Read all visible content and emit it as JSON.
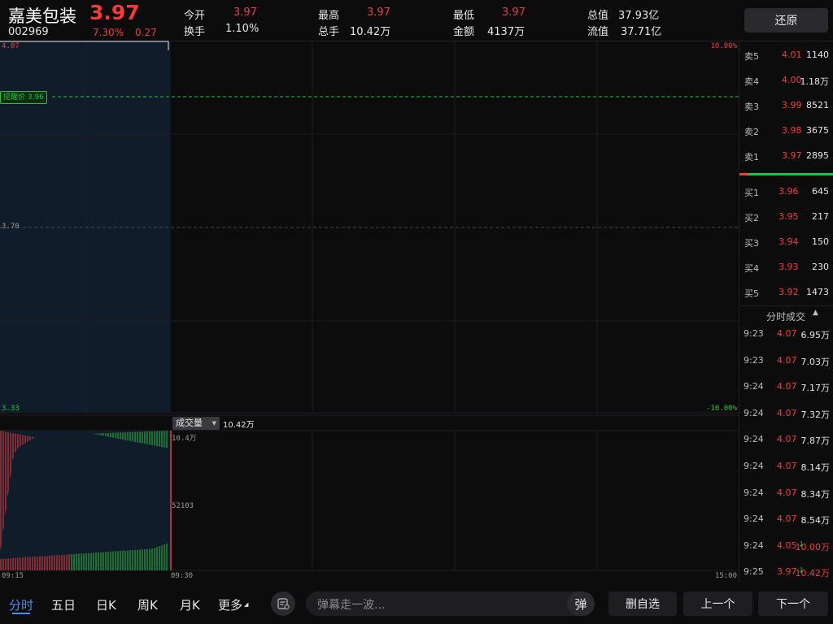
{
  "stock": {
    "name": "嘉美包装",
    "price": "3.97",
    "code": "002969",
    "change_pct": "7.30%",
    "change_amt": "0.27"
  },
  "stats": [
    {
      "label": "今开",
      "value": "3.97",
      "color": "red"
    },
    {
      "label": "换手",
      "value": "1.10%",
      "color": "white"
    },
    {
      "label": "最高",
      "value": "3.97",
      "color": "red"
    },
    {
      "label": "总手",
      "value": "10.42万",
      "color": "white"
    },
    {
      "label": "最低",
      "value": "3.97",
      "color": "red"
    },
    {
      "label": "金额",
      "value": "4137万",
      "color": "white"
    },
    {
      "label": "总值",
      "value": "37.93亿",
      "color": "white"
    },
    {
      "label": "流值",
      "value": "37.71亿",
      "color": "white"
    }
  ],
  "restore_label": "还原",
  "chart": {
    "price_top": "4.07",
    "price_mid": "3.70",
    "price_bottom": "3.33",
    "pct_top": "10.00%",
    "pct_bottom": "-10.00%",
    "alert_label": "提醒价 3.96",
    "volume_selector": "成交量",
    "volume_total": "10.42万",
    "vol_max": "10.4万",
    "vol_mid": "52103",
    "time_start": "09:15",
    "time_mid": "09:30",
    "time_end": "15:00"
  },
  "colors": {
    "up": "#f23b3b",
    "down": "#22c43a",
    "auction_bg": "#101c2a",
    "alert_line": "#22c43a"
  },
  "orderbook": {
    "sell": [
      {
        "label": "卖5",
        "price": "4.01",
        "vol": "1140"
      },
      {
        "label": "卖4",
        "price": "4.00",
        "vol": "1.18万"
      },
      {
        "label": "卖3",
        "price": "3.99",
        "vol": "8521"
      },
      {
        "label": "卖2",
        "price": "3.98",
        "vol": "3675"
      },
      {
        "label": "卖1",
        "price": "3.97",
        "vol": "2895"
      }
    ],
    "buy": [
      {
        "label": "买1",
        "price": "3.96",
        "vol": "645"
      },
      {
        "label": "买2",
        "price": "3.95",
        "vol": "217"
      },
      {
        "label": "买3",
        "price": "3.94",
        "vol": "150"
      },
      {
        "label": "买4",
        "price": "3.93",
        "vol": "230"
      },
      {
        "label": "买5",
        "price": "3.92",
        "vol": "1473"
      }
    ]
  },
  "trades_header": "分时成交",
  "trades": [
    {
      "time": "9:23",
      "price": "4.07",
      "vol": "6.95万",
      "dir": ""
    },
    {
      "time": "9:23",
      "price": "4.07",
      "vol": "7.03万",
      "dir": ""
    },
    {
      "time": "9:24",
      "price": "4.07",
      "vol": "7.17万",
      "dir": ""
    },
    {
      "time": "9:24",
      "price": "4.07",
      "vol": "7.32万",
      "dir": ""
    },
    {
      "time": "9:24",
      "price": "4.07",
      "vol": "7.87万",
      "dir": ""
    },
    {
      "time": "9:24",
      "price": "4.07",
      "vol": "8.14万",
      "dir": ""
    },
    {
      "time": "9:24",
      "price": "4.07",
      "vol": "8.34万",
      "dir": ""
    },
    {
      "time": "9:24",
      "price": "4.07",
      "vol": "8.54万",
      "dir": ""
    },
    {
      "time": "9:24",
      "price": "4.05",
      "vol": "10.00万",
      "dir": "↓"
    },
    {
      "time": "9:25",
      "price": "3.97",
      "vol": "10.42万",
      "dir": "↓"
    }
  ],
  "bottom": {
    "tabs": [
      "分时",
      "五日",
      "日K",
      "周K",
      "月K",
      "更多"
    ],
    "danmaku_placeholder": "弹幕走一波...",
    "danmaku_btn": "弹",
    "remove_fav": "删自选",
    "prev": "上一个",
    "next": "下一个"
  }
}
